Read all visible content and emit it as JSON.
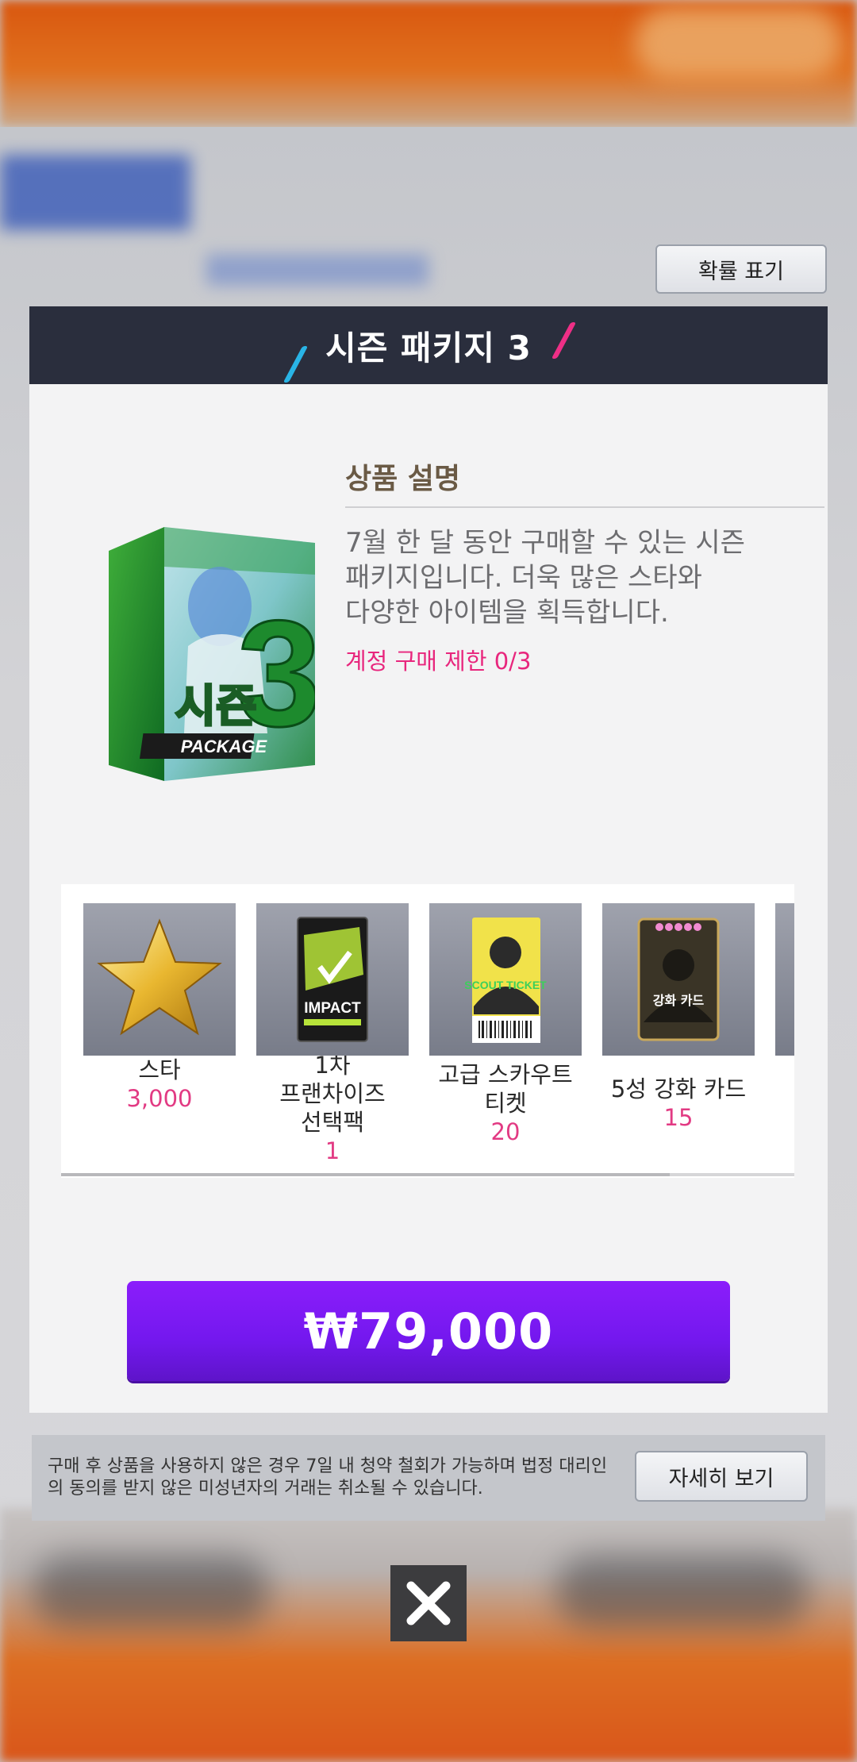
{
  "top_button": {
    "label": "확률 표기"
  },
  "dialog": {
    "title": "시즌 패키지 3",
    "description": {
      "heading": "상품 설명",
      "lines": [
        "7월 한 달 동안 구매할 수 있는 시즌",
        "패키지입니다. 더욱 많은 스타와",
        "다양한 아이템을 획득합니다."
      ],
      "limit": "계정 구매 제한 0/3"
    },
    "package_box": {
      "number": "3",
      "word": "시즌",
      "badge": "PACKAGE"
    },
    "items": [
      {
        "name": "스타",
        "qty": "3,000"
      },
      {
        "name": "1차\n프랜차이즈\n선택팩",
        "qty": "1",
        "card_text": "IMPACT"
      },
      {
        "name": "고급 스카우트\n티켓",
        "qty": "20",
        "card_text": "SCOUT TICKET"
      },
      {
        "name": "5성 강화 카드",
        "qty": "15",
        "card_text": "강화 카드"
      }
    ],
    "scroll_position": 0.83,
    "price": "₩79,000"
  },
  "notice": {
    "text": "구매 후 상품을 사용하지 않은 경우 7일 내 청약 철회가 가능하며 법정 대리인의 동의를 받지 않은 미성년자의 거래는 취소될 수 있습니다.",
    "detail_label": "자세히 보기"
  },
  "colors": {
    "accent_purple": "#7318ee",
    "pink": "#e8267d",
    "header_bg": "#2a2e3d"
  }
}
